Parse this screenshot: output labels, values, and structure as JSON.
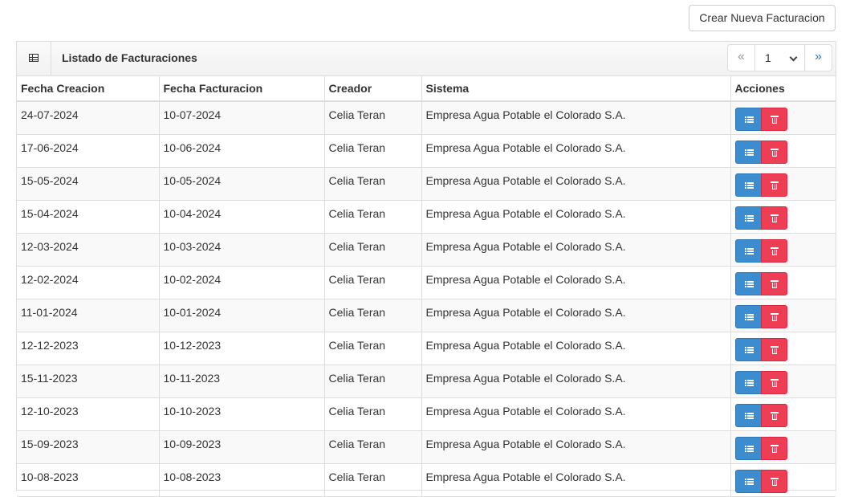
{
  "header": {
    "create_button_label": "Crear Nueva Facturacion"
  },
  "panel": {
    "title": "Listado de Facturaciones",
    "grid_icon": "table-grid-icon",
    "pagination": {
      "prev": "«",
      "current_page": "1",
      "next": "»"
    }
  },
  "table": {
    "columns": [
      "Fecha Creacion",
      "Fecha Facturacion",
      "Creador",
      "Sistema",
      "Acciones"
    ],
    "rows": [
      {
        "fecha_creacion": "24-07-2024",
        "fecha_facturacion": "10-07-2024",
        "creador": "Celia Teran",
        "sistema": "Empresa Agua Potable el Colorado S.A."
      },
      {
        "fecha_creacion": "17-06-2024",
        "fecha_facturacion": "10-06-2024",
        "creador": "Celia Teran",
        "sistema": "Empresa Agua Potable el Colorado S.A."
      },
      {
        "fecha_creacion": "15-05-2024",
        "fecha_facturacion": "10-05-2024",
        "creador": "Celia Teran",
        "sistema": "Empresa Agua Potable el Colorado S.A."
      },
      {
        "fecha_creacion": "15-04-2024",
        "fecha_facturacion": "10-04-2024",
        "creador": "Celia Teran",
        "sistema": "Empresa Agua Potable el Colorado S.A."
      },
      {
        "fecha_creacion": "12-03-2024",
        "fecha_facturacion": "10-03-2024",
        "creador": "Celia Teran",
        "sistema": "Empresa Agua Potable el Colorado S.A."
      },
      {
        "fecha_creacion": "12-02-2024",
        "fecha_facturacion": "10-02-2024",
        "creador": "Celia Teran",
        "sistema": "Empresa Agua Potable el Colorado S.A."
      },
      {
        "fecha_creacion": "11-01-2024",
        "fecha_facturacion": "10-01-2024",
        "creador": "Celia Teran",
        "sistema": "Empresa Agua Potable el Colorado S.A."
      },
      {
        "fecha_creacion": "12-12-2023",
        "fecha_facturacion": "10-12-2023",
        "creador": "Celia Teran",
        "sistema": "Empresa Agua Potable el Colorado S.A."
      },
      {
        "fecha_creacion": "15-11-2023",
        "fecha_facturacion": "10-11-2023",
        "creador": "Celia Teran",
        "sistema": "Empresa Agua Potable el Colorado S.A."
      },
      {
        "fecha_creacion": "12-10-2023",
        "fecha_facturacion": "10-10-2023",
        "creador": "Celia Teran",
        "sistema": "Empresa Agua Potable el Colorado S.A."
      },
      {
        "fecha_creacion": "15-09-2023",
        "fecha_facturacion": "10-09-2023",
        "creador": "Celia Teran",
        "sistema": "Empresa Agua Potable el Colorado S.A."
      },
      {
        "fecha_creacion": "10-08-2023",
        "fecha_facturacion": "10-08-2023",
        "creador": "Celia Teran",
        "sistema": "Empresa Agua Potable el Colorado S.A."
      }
    ],
    "row_action_icons": [
      "list-icon",
      "trash-icon"
    ]
  },
  "colors": {
    "list_button": "#3c8dd0",
    "delete_button": "#ee3e55",
    "pager_next": "#337ab7"
  }
}
